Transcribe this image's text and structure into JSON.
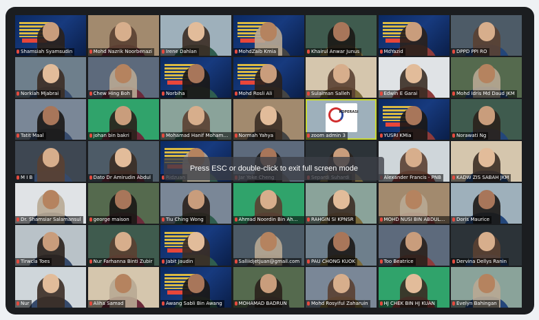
{
  "meeting": {
    "overlay_message": "Press ESC or double-click to exit full screen mode",
    "accent_colors": {
      "frame": "#1b1d20",
      "active_speaker": "#c9d832",
      "muted_mic": "#e34b3f"
    }
  },
  "participants": [
    {
      "name": "Shamsiah Syamsudin",
      "muted": true,
      "video": "banner"
    },
    {
      "name": "Mohd Nazrik Noorbenazi",
      "muted": true,
      "video": "camera"
    },
    {
      "name": "Irene Dahlan",
      "muted": true,
      "video": "camera"
    },
    {
      "name": "MohdZaib Kmia",
      "muted": true,
      "video": "banner"
    },
    {
      "name": "Khairul Anwar Junus",
      "muted": true,
      "video": "camera"
    },
    {
      "name": "MdYazid",
      "muted": true,
      "video": "banner"
    },
    {
      "name": "DPPD PPI RO",
      "muted": true,
      "video": "camera"
    },
    {
      "name": "Norkiah Mjabrai",
      "muted": true,
      "video": "camera"
    },
    {
      "name": "Chew Hing Boh",
      "muted": true,
      "video": "camera"
    },
    {
      "name": "Norbiha",
      "muted": true,
      "video": "banner"
    },
    {
      "name": "Mohd Rosli Ali",
      "muted": true,
      "video": "banner"
    },
    {
      "name": "Sulaiman Salleh",
      "muted": true,
      "video": "camera"
    },
    {
      "name": "Edwin E Garai",
      "muted": true,
      "video": "camera"
    },
    {
      "name": "Mohd Idris Md Daud JKM",
      "muted": true,
      "video": "camera"
    },
    {
      "name": "Tatit Maal",
      "muted": true,
      "video": "camera"
    },
    {
      "name": "johan bin bakri",
      "muted": true,
      "video": "camera"
    },
    {
      "name": "Mohamad Hanif Mohamad",
      "muted": true,
      "video": "camera"
    },
    {
      "name": "Normah Yahya",
      "muted": true,
      "video": "camera"
    },
    {
      "name": "zoom admin 3",
      "muted": true,
      "video": "logo",
      "active": true
    },
    {
      "name": "YUSRI KMia",
      "muted": true,
      "video": "banner"
    },
    {
      "name": "Norawati Ng",
      "muted": true,
      "video": "camera"
    },
    {
      "name": "M I B",
      "muted": true,
      "video": "camera"
    },
    {
      "name": "Dato Dr Amirudin Abdul",
      "muted": true,
      "video": "camera"
    },
    {
      "name": "Ridzuan",
      "muted": true,
      "video": "banner"
    },
    {
      "name": "Jar Yoke Cheng",
      "muted": true,
      "video": "camera"
    },
    {
      "name": "Separdi Suhardi",
      "muted": true,
      "video": "camera"
    },
    {
      "name": "Alexander Francis - PNB",
      "muted": true,
      "video": "camera"
    },
    {
      "name": "KADW ZIS SABAH JKM",
      "muted": true,
      "video": "camera"
    },
    {
      "name": "Dr. Shamsiar Salamansul",
      "muted": true,
      "video": "camera"
    },
    {
      "name": "george maison",
      "muted": true,
      "video": "camera"
    },
    {
      "name": "Tiu Ching Wong",
      "muted": true,
      "video": "camera"
    },
    {
      "name": "Ahmad Noordin Bin Ahmad",
      "muted": true,
      "video": "camera"
    },
    {
      "name": "RAHGIN SI KPNSR",
      "muted": true,
      "video": "camera"
    },
    {
      "name": "MOHD NUSI BIN ABDULLAH",
      "muted": true,
      "video": "camera"
    },
    {
      "name": "Doris Maurice",
      "muted": true,
      "video": "camera"
    },
    {
      "name": "Tirwcla Toes",
      "muted": true,
      "video": "camera"
    },
    {
      "name": "Nur Farhanna Binti Zubir",
      "muted": true,
      "video": "camera"
    },
    {
      "name": "Jabit Jaudin",
      "muted": true,
      "video": "banner"
    },
    {
      "name": "Salliidjetjuan@gmail.com",
      "muted": true,
      "video": "camera"
    },
    {
      "name": "PAU CHONG KUOK",
      "muted": true,
      "video": "camera"
    },
    {
      "name": "Too Beatrice",
      "muted": true,
      "video": "camera"
    },
    {
      "name": "Dervina Dellys Ranin",
      "muted": true,
      "video": "camera"
    },
    {
      "name": "Nur",
      "muted": true,
      "video": "camera"
    },
    {
      "name": "Aliha Samad",
      "muted": true,
      "video": "camera"
    },
    {
      "name": "Awang Sabli Bin Awang",
      "muted": true,
      "video": "banner"
    },
    {
      "name": "MOHAMAD BADRUN",
      "muted": true,
      "video": "camera"
    },
    {
      "name": "Mohd Rosyiful Zaharuin",
      "muted": true,
      "video": "camera"
    },
    {
      "name": "HJ CHEK BIN HJ KUAN",
      "muted": true,
      "video": "camera"
    },
    {
      "name": "Evelyn Bahingan",
      "muted": true,
      "video": "camera"
    }
  ]
}
